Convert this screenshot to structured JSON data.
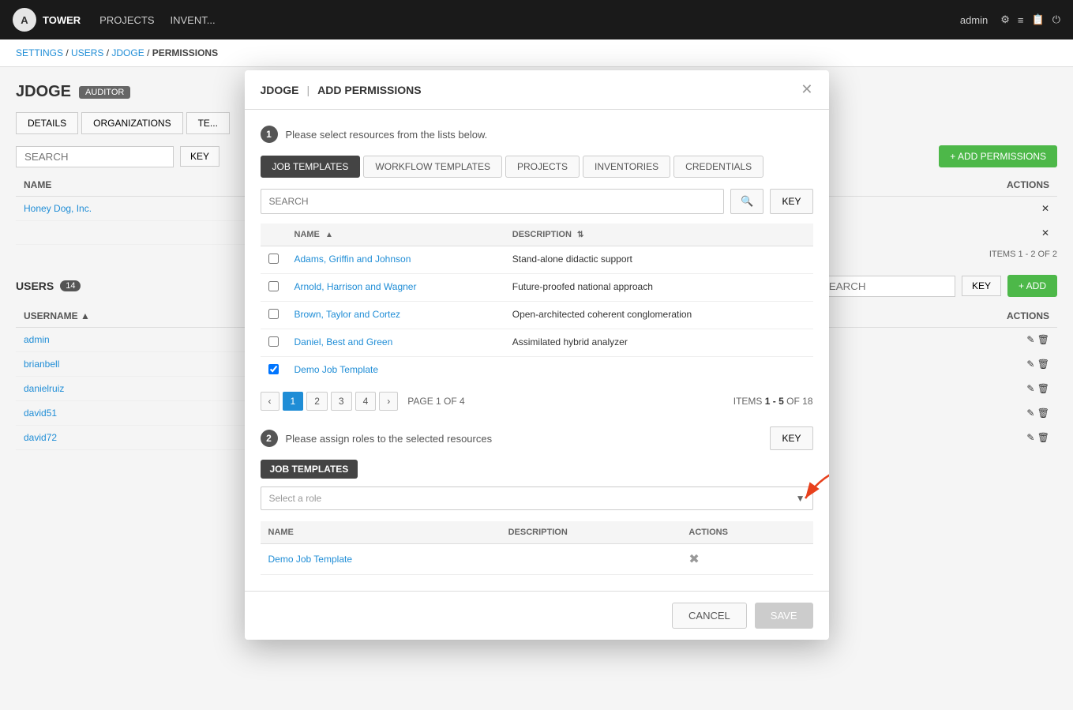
{
  "topNav": {
    "logo": "A",
    "appName": "TOWER",
    "navItems": [
      "PROJECTS",
      "INVENT..."
    ],
    "adminLabel": "admin",
    "icons": [
      "gear-icon",
      "list-icon",
      "book-icon",
      "power-icon"
    ]
  },
  "breadcrumb": {
    "items": [
      "SETTINGS",
      "USERS",
      "JDOGE",
      "PERMISSIONS"
    ]
  },
  "userSection": {
    "name": "JDOGE",
    "badge": "AUDITOR",
    "tabs": [
      "DETAILS",
      "ORGANIZATIONS",
      "TE..."
    ]
  },
  "modal": {
    "user": "JDOGE",
    "separator": "|",
    "title": "ADD PERMISSIONS",
    "step1": {
      "number": "1",
      "text": "Please select resources from the lists below."
    },
    "resourceTabs": [
      {
        "label": "JOB TEMPLATES",
        "active": true
      },
      {
        "label": "WORKFLOW TEMPLATES",
        "active": false
      },
      {
        "label": "PROJECTS",
        "active": false
      },
      {
        "label": "INVENTORIES",
        "active": false
      },
      {
        "label": "CREDENTIALS",
        "active": false
      }
    ],
    "search": {
      "placeholder": "SEARCH",
      "keyLabel": "KEY"
    },
    "tableHeaders": {
      "name": "NAME",
      "nameSortIcon": "▲",
      "description": "DESCRIPTION",
      "descSortIcon": "⇅"
    },
    "tableRows": [
      {
        "id": 1,
        "name": "Adams, Griffin and Johnson",
        "description": "Stand-alone didactic support",
        "checked": false
      },
      {
        "id": 2,
        "name": "Arnold, Harrison and Wagner",
        "description": "Future-proofed national approach",
        "checked": false
      },
      {
        "id": 3,
        "name": "Brown, Taylor and Cortez",
        "description": "Open-architected coherent conglomeration",
        "checked": false
      },
      {
        "id": 4,
        "name": "Daniel, Best and Green",
        "description": "Assimilated hybrid analyzer",
        "checked": false
      },
      {
        "id": 5,
        "name": "Demo Job Template",
        "description": "",
        "checked": true
      }
    ],
    "pagination": {
      "pages": [
        "1",
        "2",
        "3",
        "4"
      ],
      "activePage": "1",
      "pageLabel": "PAGE 1 OF 4",
      "itemsLabel": "ITEMS",
      "itemsRange": "1 - 5",
      "itemsTotal": "OF 18"
    },
    "step2": {
      "number": "2",
      "text": "Please assign roles to the selected resources",
      "keyLabel": "KEY"
    },
    "sectionTag": "JOB TEMPLATES",
    "roleSelect": {
      "placeholder": "Select a role"
    },
    "selectedTableHeaders": {
      "name": "NAME",
      "description": "DESCRIPTION",
      "actions": "ACTIONS"
    },
    "selectedItems": [
      {
        "name": "Demo Job Template",
        "description": ""
      }
    ],
    "footer": {
      "cancelLabel": "CANCEL",
      "saveLabel": "SAVE"
    }
  },
  "permissionsSection": {
    "searchPlaceholder": "SEARCH",
    "keyLabel": "KEY",
    "addButton": "+ ADD PERMISSIONS",
    "tableHeaders": [
      "NAME",
      "ACTIONS"
    ],
    "items": [
      "Honey Dog, Inc."
    ],
    "itemsLabel": "ITEMS 1 - 2 OF 2"
  },
  "usersSection": {
    "title": "USERS",
    "count": "14",
    "searchPlaceholder": "SEARCH",
    "keyLabel": "KEY",
    "addButton": "+ ADD",
    "tableHeaders": [
      "USERNAME",
      "ACTIONS"
    ],
    "users": [
      "admin",
      "brianbell",
      "danielruiz",
      "david51",
      "david72"
    ]
  }
}
